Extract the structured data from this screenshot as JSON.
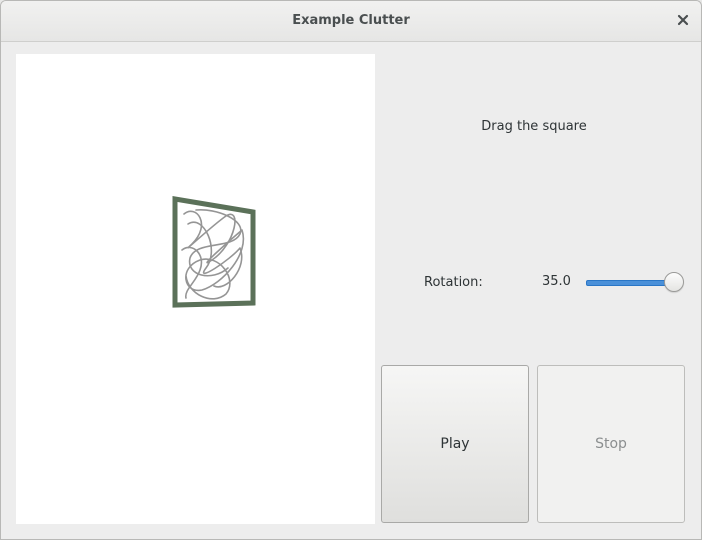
{
  "window": {
    "title": "Example Clutter",
    "close_icon": "close-icon"
  },
  "stage": {
    "actor_icon": "scribble-square-icon"
  },
  "panel": {
    "hint": "Drag the square",
    "rotation_label": "Rotation:",
    "rotation_value": "35.0",
    "rotation_level": 1.0,
    "play_label": "Play",
    "stop_label": "Stop",
    "stop_enabled": false
  },
  "colors": {
    "slider_fill": "#4a90d9",
    "square_border": "#5b7159",
    "stage_bg": "#ffffff"
  }
}
